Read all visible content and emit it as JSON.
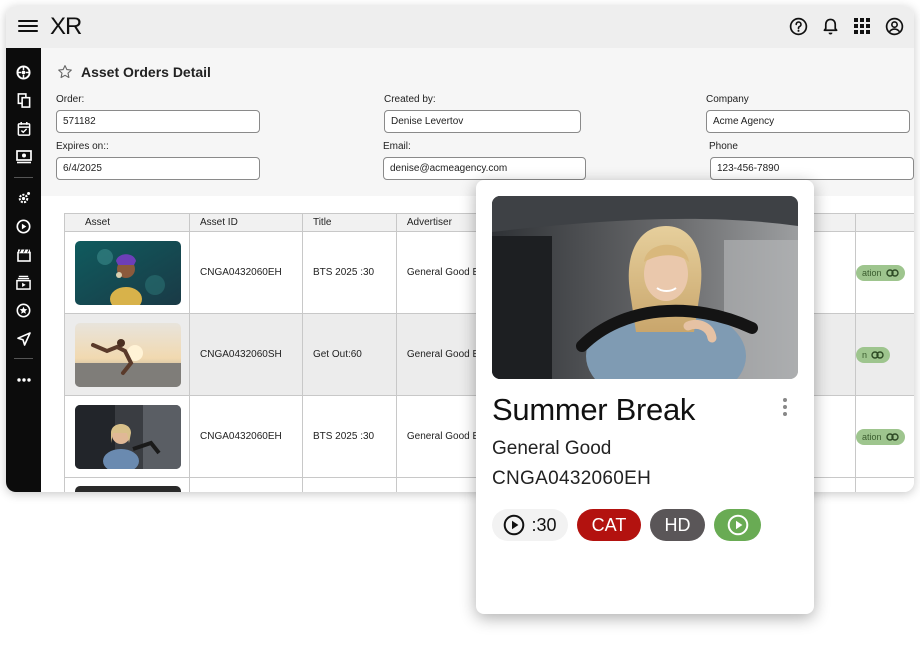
{
  "app": {
    "logo": "XR"
  },
  "topbar": {
    "icons": [
      "menu-icon",
      "help-icon",
      "bell-icon",
      "apps-grid-icon",
      "account-icon"
    ]
  },
  "sidebar": {
    "icons": [
      "dashboard-icon",
      "copy-icon",
      "calendar-check-icon",
      "money-icon",
      "settings-gear-icon",
      "play-circle-icon",
      "clapperboard-icon",
      "video-library-icon",
      "star-badge-icon",
      "send-icon",
      "more-icon"
    ]
  },
  "page": {
    "title": "Asset Orders Detail",
    "fields": {
      "order": {
        "label": "Order:",
        "value": "571182"
      },
      "created_by": {
        "label": "Created by:",
        "value": "Denise Levertov"
      },
      "company": {
        "label": "Company",
        "value": "Acme Agency"
      },
      "expires_on": {
        "label": "Expires on::",
        "value": "6/4/2025"
      },
      "email": {
        "label": "Email:",
        "value": "denise@acmeagency.com"
      },
      "phone": {
        "label": "Phone",
        "value": "123-456-7890"
      }
    }
  },
  "table": {
    "headers": [
      "Asset",
      "Asset ID",
      "Title",
      "Advertiser"
    ],
    "rows": [
      {
        "asset_id": "CNGA0432060EH",
        "title": "BTS 2025 :30",
        "advertiser": "General Good E",
        "status": "ation"
      },
      {
        "asset_id": "CNGA0432060SH",
        "title": "Get Out:60",
        "advertiser": "General Good E",
        "status": "n"
      },
      {
        "asset_id": "CNGA0432060EH",
        "title": "BTS 2025 :30",
        "advertiser": "General Good E",
        "status": "ation"
      }
    ]
  },
  "card": {
    "title": "Summer Break",
    "advertiser": "General Good",
    "asset_id": "CNGA0432060EH",
    "duration": ":30",
    "badge_cat": "CAT",
    "badge_hd": "HD"
  },
  "colors": {
    "sidebar": "#0c0c0c",
    "topbar": "#eeeeee",
    "cat_badge": "#b3120f",
    "hd_badge": "#5a5658",
    "play_badge": "#69ab54",
    "status_pill": "#9ec58e"
  }
}
